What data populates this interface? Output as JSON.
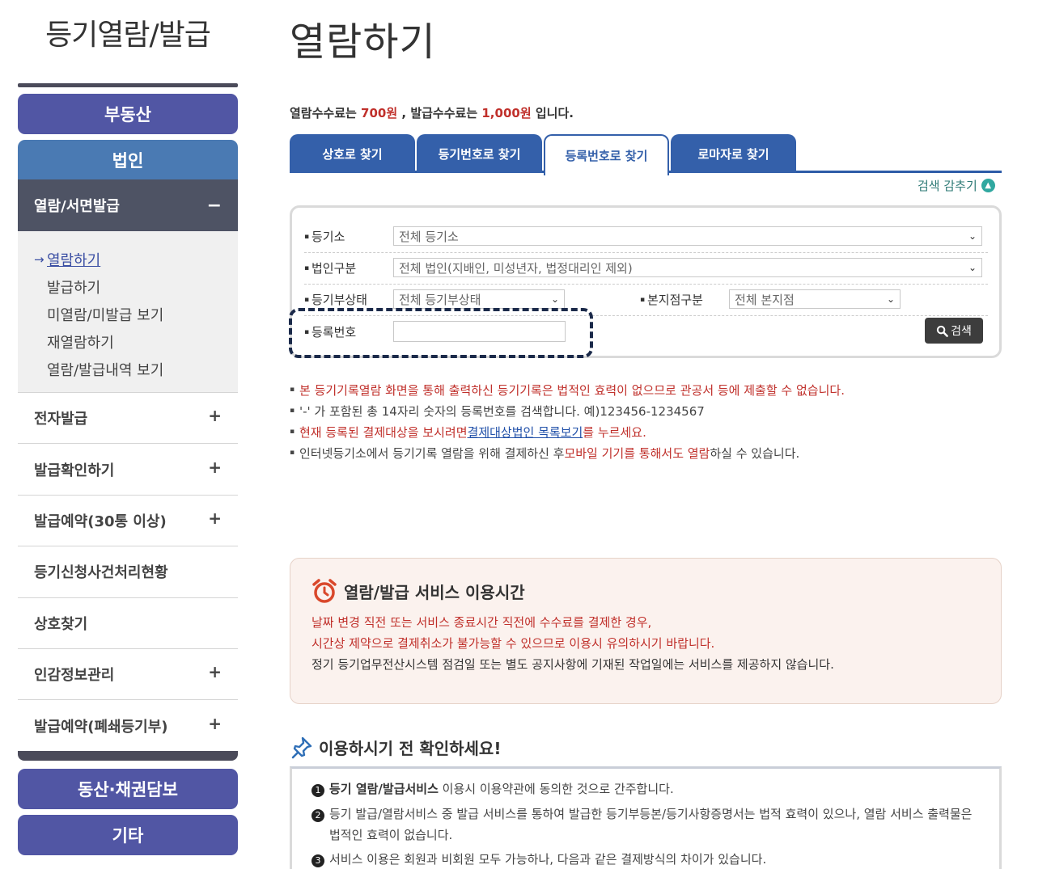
{
  "sidebar": {
    "title": "등기열람/발급",
    "categories": {
      "real_estate": "부동산",
      "corporation": "법인",
      "movable": "동산·채권담보",
      "etc": "기타"
    },
    "active_section": {
      "label": "열람/서면발급",
      "toggle": "−"
    },
    "sub_items": [
      {
        "label": "열람하기",
        "arrow": "→"
      },
      {
        "label": "발급하기"
      },
      {
        "label": "미열람/미발급 보기"
      },
      {
        "label": "재열람하기"
      },
      {
        "label": "열람/발급내역 보기"
      }
    ],
    "menu_items": [
      {
        "label": "전자발급",
        "toggle": "+"
      },
      {
        "label": "발급확인하기",
        "toggle": "+"
      },
      {
        "label": "발급예약(30통 이상)",
        "toggle": "+"
      },
      {
        "label": "등기신청사건처리현황",
        "toggle": ""
      },
      {
        "label": "상호찾기",
        "toggle": ""
      },
      {
        "label": "인감정보관리",
        "toggle": "+"
      },
      {
        "label": "발급예약(폐쇄등기부)",
        "toggle": "+"
      }
    ]
  },
  "main": {
    "title": "열람하기",
    "fee": {
      "prefix": "열람수수료는",
      "view_fee": "700원",
      "mid": ", 발급수수료는",
      "issue_fee": "1,000원",
      "suffix": "입니다."
    },
    "tabs": [
      "상호로 찾기",
      "등기번호로 찾기",
      "등록번호로 찾기",
      "로마자로 찾기"
    ],
    "active_tab": 2,
    "hide_search": "검색 감추기",
    "form": {
      "registry_label": "등기소",
      "registry_value": "전체 등기소",
      "corp_type_label": "법인구분",
      "corp_type_value": "전체 법인(지배인, 미성년자, 법정대리인 제외)",
      "status_label": "등기부상태",
      "status_value": "전체 등기부상태",
      "branch_label": "본지점구분",
      "branch_value": "전체 본지점",
      "regno_label": "등록번호",
      "regno_value": "",
      "search_button": "검색"
    },
    "notes": {
      "n1": "본 등기기록열람 화면을 통해 출력하신 등기기록은 법적인 효력이 없으므로 관공서 등에 제출할 수 없습니다.",
      "n2": "'-' 가 포함된 총 14자리 숫자의 등록번호를 검색합니다. 예)123456-1234567",
      "n3_a": "현재 등록된 결제대상을 보시려면 ",
      "n3_link": "결제대상법인 목록보기",
      "n3_b": "를 누르세요.",
      "n4_a": "인터넷등기소에서 등기기록 열람을 위해 결제하신 후 ",
      "n4_red": "모바일 기기를 통해서도 열람",
      "n4_b": "하실 수 있습니다."
    },
    "service": {
      "title": "열람/발급 서비스 이용시간",
      "line1": "날짜 변경 직전 또는 서비스 종료시간 직전에 수수료를 결제한 경우,",
      "line2": "시간상 제약으로 결제취소가 불가능할 수 있으므로 이용시 유의하시기 바랍니다.",
      "line3": "정기 등기업무전산시스템 점검일 또는 별도 공지사항에 기재된 작업일에는 서비스를 제공하지 않습니다."
    },
    "check": {
      "title": "이용하시기 전 확인하세요!",
      "items": [
        {
          "num": "1",
          "bold": "등기 열람/발급서비스",
          "text": " 이용시 이용약관에 동의한 것으로 간주합니다."
        },
        {
          "num": "2",
          "bold": "",
          "text": "등기 발급/열람서비스 중 발급 서비스를 통하여 발급한 등기부등본/등기사항증명서는 법적 효력이 있으나, 열람 서비스 출력물은 법적인 효력이 없습니다."
        },
        {
          "num": "3",
          "bold": "",
          "text": "서비스 이용은 회원과 비회원 모두 가능하나, 다음과 같은 결제방식의 차이가 있습니다."
        }
      ]
    }
  },
  "colors": {
    "tab_blue": "#3460aa",
    "nav_indigo": "#5156a4",
    "alert_red": "#c0302b"
  }
}
